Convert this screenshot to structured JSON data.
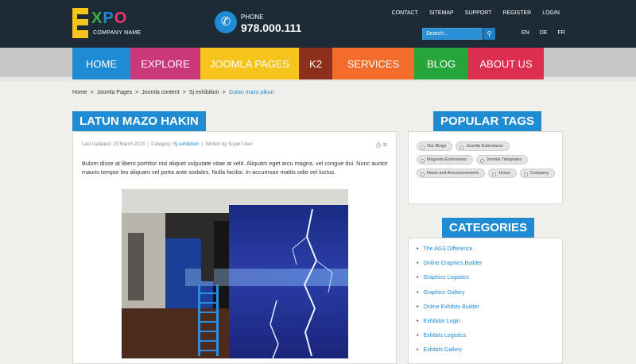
{
  "brand": {
    "logo_letters": [
      "E",
      "X",
      "P",
      "O"
    ],
    "tagline": "COMPANY NAME",
    "colors": {
      "yellow": "#f6c41a",
      "green": "#3fae49",
      "blue": "#1f8bd2",
      "pink": "#e63a78"
    }
  },
  "phone": {
    "label": "PHONE",
    "number": "978.000.111",
    "icon": "phone-icon"
  },
  "top_links": [
    "CONTACT",
    "SITEMAP",
    "SUPPORT",
    "REGISTER",
    "LOGIN"
  ],
  "search": {
    "placeholder": "Search...",
    "icon": "search-icon"
  },
  "languages": [
    "EN",
    "DE",
    "FR"
  ],
  "nav": [
    {
      "label": "HOME",
      "color": "#1f8bd2"
    },
    {
      "label": "EXPLORE",
      "color": "#c9397a"
    },
    {
      "label": "JOOMLA PAGES",
      "color": "#f6c41a"
    },
    {
      "label": "K2",
      "color": "#8c2f1c"
    },
    {
      "label": "SERVICES",
      "color": "#f26c2b"
    },
    {
      "label": "BLOG",
      "color": "#26a53b"
    },
    {
      "label": "ABOUT US",
      "color": "#dc2f4f"
    }
  ],
  "breadcrumb": [
    "Home",
    "Joomla Pages",
    "Joomla content",
    "Sj exhibition",
    "Gutan mazo pikun"
  ],
  "article": {
    "title": "LATUN MAZO HAKIN",
    "updated": "Last Updated: 23 March 2013",
    "category_label": "Category:",
    "category_value": "Sj exhibition",
    "author": "Written by Super User",
    "body": "Bulom disse at libero porttitor nisi aliquet vulputate vitae at velit. Aliquam eget arcu magna. vel congue dui. Nunc auctor mauris tempor leo aliquam vel porta ante sodales. Nulla facilisi. In accumsan mattis odio vel luctus."
  },
  "popular_tags": {
    "title": "POPULAR TAGS",
    "tags": [
      "Our Blogs",
      "Joomla Extensions",
      "Magento Extensions",
      "Joomla Templates",
      "News and Announcements",
      "Ursus",
      "Company"
    ]
  },
  "categories": {
    "title": "CATEGORIES",
    "items": [
      "The AGS Difference",
      "Online Graphics Builder",
      "Graphics Logistics",
      "Graphics Gallery",
      "Online Exhibits Builder",
      "Exhibitor Login",
      "Exhibits Logistics",
      "Exhibits Gallery"
    ]
  }
}
